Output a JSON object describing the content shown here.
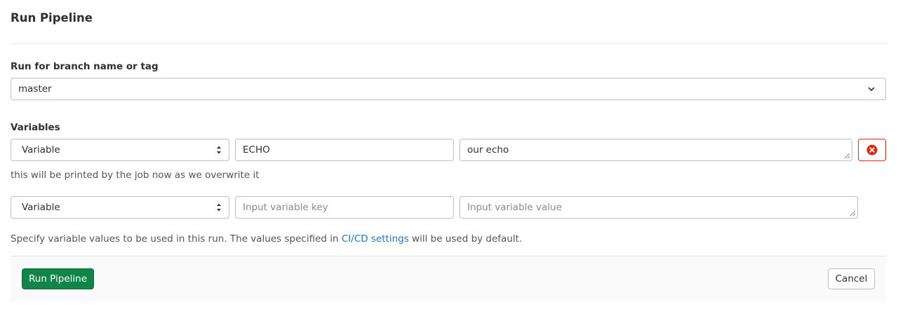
{
  "page": {
    "title": "Run Pipeline"
  },
  "branch": {
    "label": "Run for branch name or tag",
    "value": "master"
  },
  "variables": {
    "label": "Variables",
    "rows": [
      {
        "type": "Variable",
        "key": "ECHO",
        "value": "our echo",
        "description": "this will be printed by the job now as we overwrite it"
      },
      {
        "type": "Variable",
        "key_placeholder": "Input variable key",
        "value_placeholder": "Input variable value"
      }
    ],
    "help_prefix": "Specify variable values to be used in this run. The values specified in ",
    "help_link": "CI/CD settings",
    "help_suffix": " will be used by default."
  },
  "actions": {
    "run_label": "Run Pipeline",
    "cancel_label": "Cancel"
  },
  "colors": {
    "primary": "#108548",
    "danger": "#dd2b0e",
    "link": "#1f75cb"
  },
  "icons": {
    "branch_dropdown": "chevron-down-icon",
    "type_select": "select-arrows-icon",
    "remove": "remove-circle-icon"
  }
}
